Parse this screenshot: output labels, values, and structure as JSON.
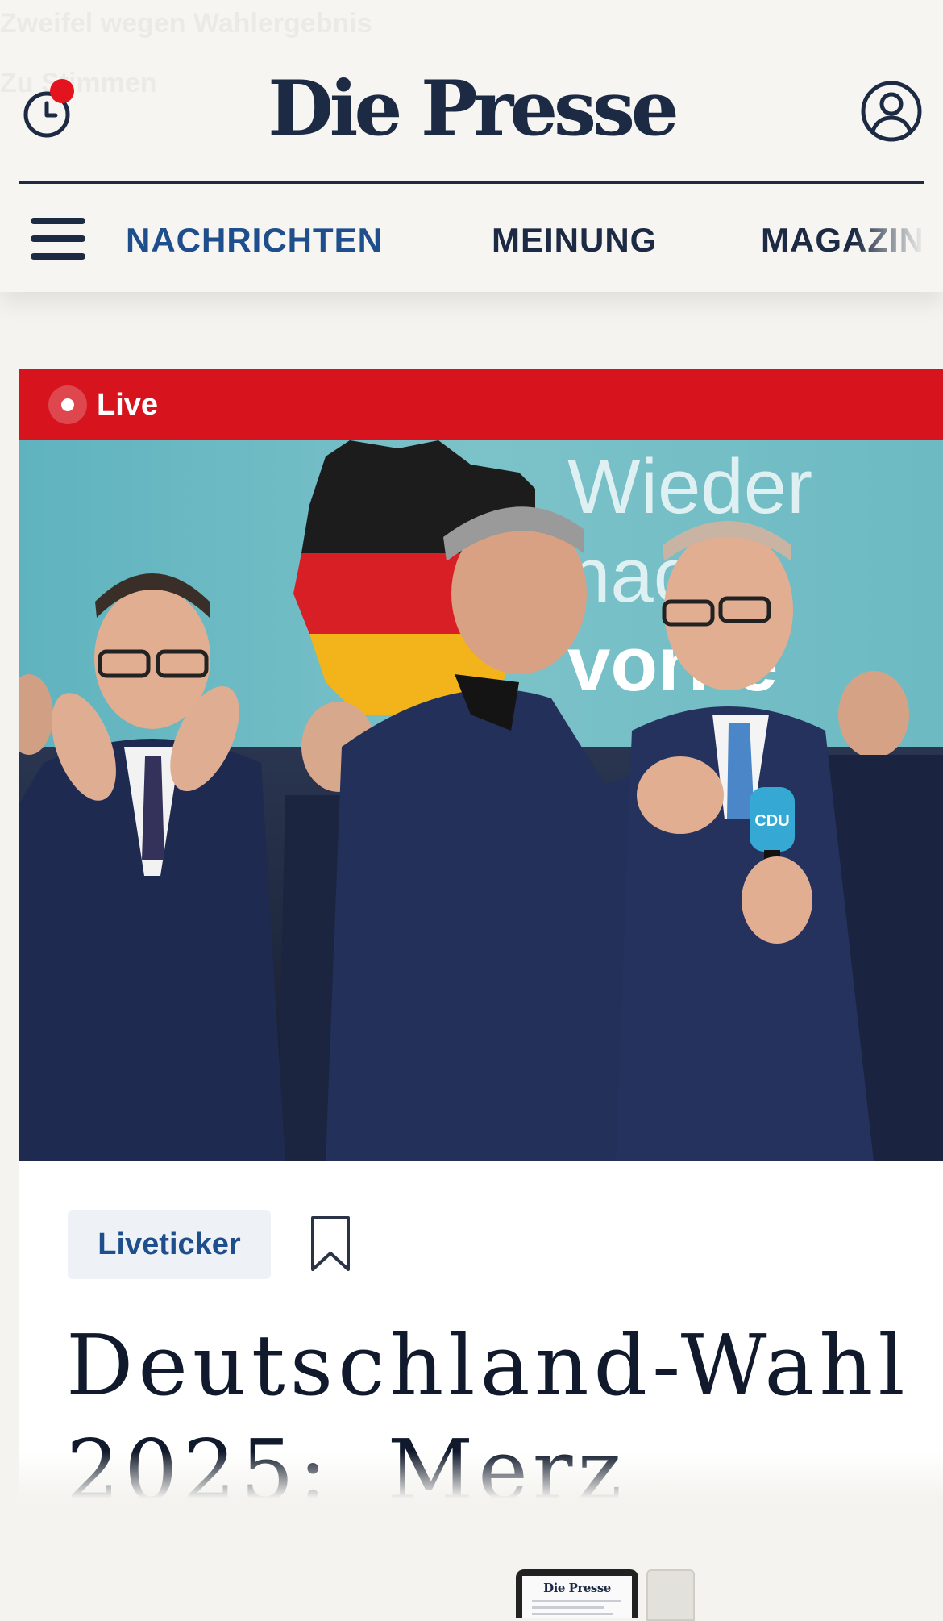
{
  "header": {
    "logo": "Die Presse",
    "ghost_line_1": "Zweifel wegen Wahlergebnis",
    "ghost_line_2": "Zu Stimmen",
    "history_icon": "clock-icon",
    "account_icon": "user-circle-icon",
    "notification_color": "#e3141e"
  },
  "nav": {
    "menu_icon": "hamburger-menu-icon",
    "items": [
      {
        "label": "NACHRICHTEN",
        "active": true
      },
      {
        "label": "MEINUNG",
        "active": false
      },
      {
        "label": "MAGAZIN",
        "active": false
      }
    ],
    "active_color": "#1f4e8c",
    "color": "#1d2a44"
  },
  "article": {
    "live_label": "Live",
    "live_color": "#d7141d",
    "hero_image": {
      "kind": "photo",
      "backdrop_text": [
        "Wieder",
        "nach",
        "vorne"
      ],
      "mic_label": "CDU"
    },
    "tag": "Liveticker",
    "bookmark_icon": "bookmark-icon",
    "headline_line_1": "Deutschland-Wahl",
    "headline_line_2": "2025: Merz"
  },
  "promo": {
    "logo": "Die Presse"
  }
}
